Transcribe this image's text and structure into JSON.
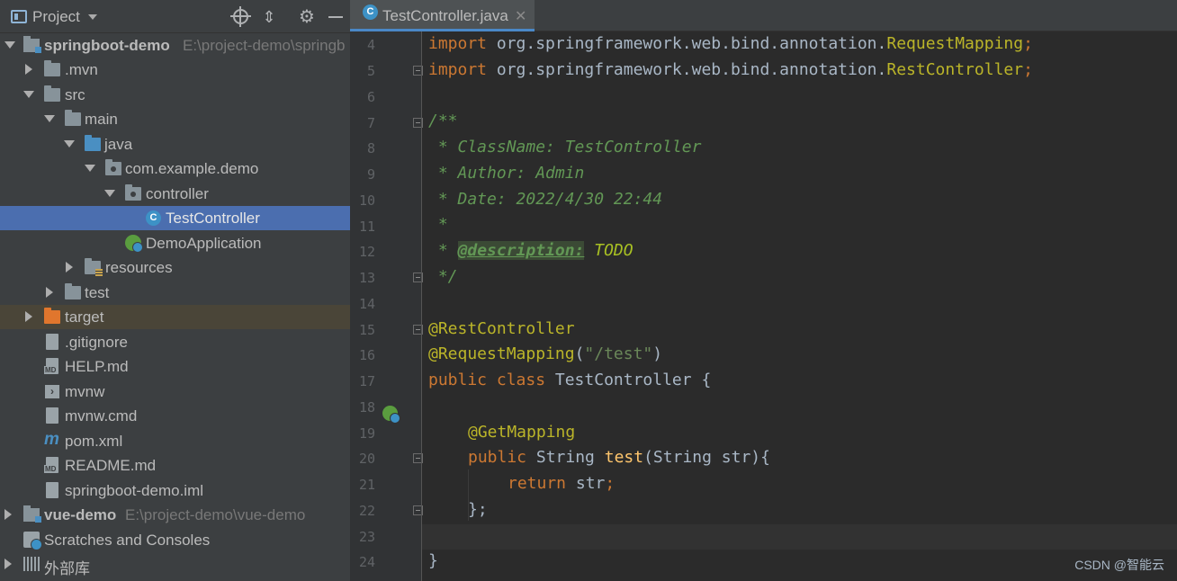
{
  "project_panel": {
    "title": "Project",
    "tree": [
      {
        "label": "springboot-demo",
        "path": "E:\\project-demo\\springb",
        "bold": true
      },
      {
        "label": ".mvn"
      },
      {
        "label": "src"
      },
      {
        "label": "main"
      },
      {
        "label": "java"
      },
      {
        "label": "com.example.demo"
      },
      {
        "label": "controller"
      },
      {
        "label": "TestController"
      },
      {
        "label": "DemoApplication"
      },
      {
        "label": "resources"
      },
      {
        "label": "test"
      },
      {
        "label": "target"
      },
      {
        "label": ".gitignore"
      },
      {
        "label": "HELP.md"
      },
      {
        "label": "mvnw"
      },
      {
        "label": "mvnw.cmd"
      },
      {
        "label": "pom.xml"
      },
      {
        "label": "README.md"
      },
      {
        "label": "springboot-demo.iml"
      },
      {
        "label": "vue-demo",
        "path": "E:\\project-demo\\vue-demo",
        "bold": true
      },
      {
        "label": "Scratches and Consoles"
      },
      {
        "label": "外部库"
      }
    ]
  },
  "editor": {
    "tab_title": "TestController.java",
    "tab_icon_letter": "C",
    "line_numbers": [
      "4",
      "5",
      "6",
      "7",
      "8",
      "9",
      "10",
      "11",
      "12",
      "13",
      "14",
      "15",
      "16",
      "17",
      "18",
      "19",
      "20",
      "21",
      "22",
      "23",
      "24"
    ],
    "code": {
      "l4_kw": "import",
      "l4_pkg": " org.springframework.web.bind.annotation.",
      "l4_cls": "RequestMapping",
      "l4_semi": ";",
      "l5_kw": "import",
      "l5_pkg": " org.springframework.web.bind.annotation.",
      "l5_cls": "RestController",
      "l5_semi": ";",
      "l7": "/**",
      "l8": " * ClassName: TestController",
      "l9": " * Author: Admin",
      "l10": " * Date: 2022/4/30 22:44",
      "l11": " *",
      "l12_pre": " * ",
      "l12_tag": "@description:",
      "l12_todo": " TODO",
      "l13": " */",
      "l15": "@RestController",
      "l16_an": "@RequestMapping",
      "l16_open": "(",
      "l16_str": "\"/test\"",
      "l16_close": ")",
      "l17_kw": "public class",
      "l17_rest": " TestController {",
      "l19": "@GetMapping",
      "l20_kw": "public",
      "l20_type": " String ",
      "l20_fn": "test",
      "l20_rest": "(String str){",
      "l21_kw": "return",
      "l21_rest": " str",
      "l21_semi": ";",
      "l22": "};",
      "l24": "}"
    }
  },
  "watermark": "CSDN @智能云",
  "colors": {
    "selection": "#4b6eaf",
    "keyword": "#cc7832",
    "annotation": "#bbb529",
    "doc_comment": "#629755",
    "string": "#6a8759",
    "method": "#ffc66d"
  }
}
